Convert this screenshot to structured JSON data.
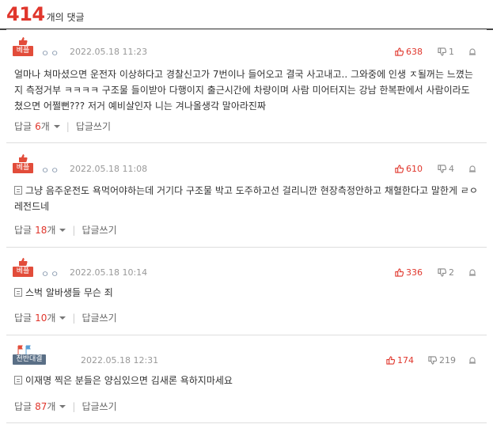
{
  "header": {
    "count": "414",
    "label": "개의 댓글"
  },
  "colors": {
    "accent": "#e0362c",
    "grade_badge": "#5a6f86"
  },
  "comments": [
    {
      "badge": "베플",
      "badge_type": "best",
      "nickname": "ㅇㅇ",
      "date": "2022.05.18 11:23",
      "up": "638",
      "down": "1",
      "text": "얼마나 쳐마셨으면 운전자 이상하다고 경찰신고가 7번이나 들어오고 결국 사고내고.. 그와중에 인생 ㅈ될꺼는 느꼈는지 측정거부 ㅋㅋㅋㅋ 구조물 들이받아 다행이지 출근시간에 차량이며 사람 미어터지는 강남 한복판에서 사람이라도 쳤으면 어쩔뻔??? 저거 예비살인자 니는 겨나올생각 말아라진짜",
      "has_doc_icon": false,
      "reply_label": "답글",
      "reply_count": "6",
      "reply_unit": "개",
      "write_reply": "답글쓰기"
    },
    {
      "badge": "베플",
      "badge_type": "best",
      "nickname": "ㅇㅇ",
      "date": "2022.05.18 11:08",
      "up": "610",
      "down": "4",
      "text": "그냥 음주운전도 욕먹어야하는데 거기다 구조물 박고 도주하고선 걸리니깐 현장측정안하고 채혈한다고 말한게 ㄹㅇ 레전드네",
      "has_doc_icon": true,
      "reply_label": "답글",
      "reply_count": "18",
      "reply_unit": "개",
      "write_reply": "답글쓰기"
    },
    {
      "badge": "베플",
      "badge_type": "best",
      "nickname": "ㅇㅇ",
      "date": "2022.05.18 10:14",
      "up": "336",
      "down": "2",
      "text": "스벅 알바생들 무슨 죄",
      "has_doc_icon": true,
      "reply_label": "답글",
      "reply_count": "10",
      "reply_unit": "개",
      "write_reply": "답글쓰기"
    },
    {
      "badge": "천반대결",
      "badge_type": "grade",
      "nickname": "",
      "date": "2022.05.18 12:31",
      "up": "174",
      "down": "219",
      "text": "이재명 찍은 분들은 양심있으면 김새론 욕하지마세요",
      "has_doc_icon": true,
      "reply_label": "답글",
      "reply_count": "87",
      "reply_unit": "개",
      "write_reply": "답글쓰기"
    }
  ]
}
